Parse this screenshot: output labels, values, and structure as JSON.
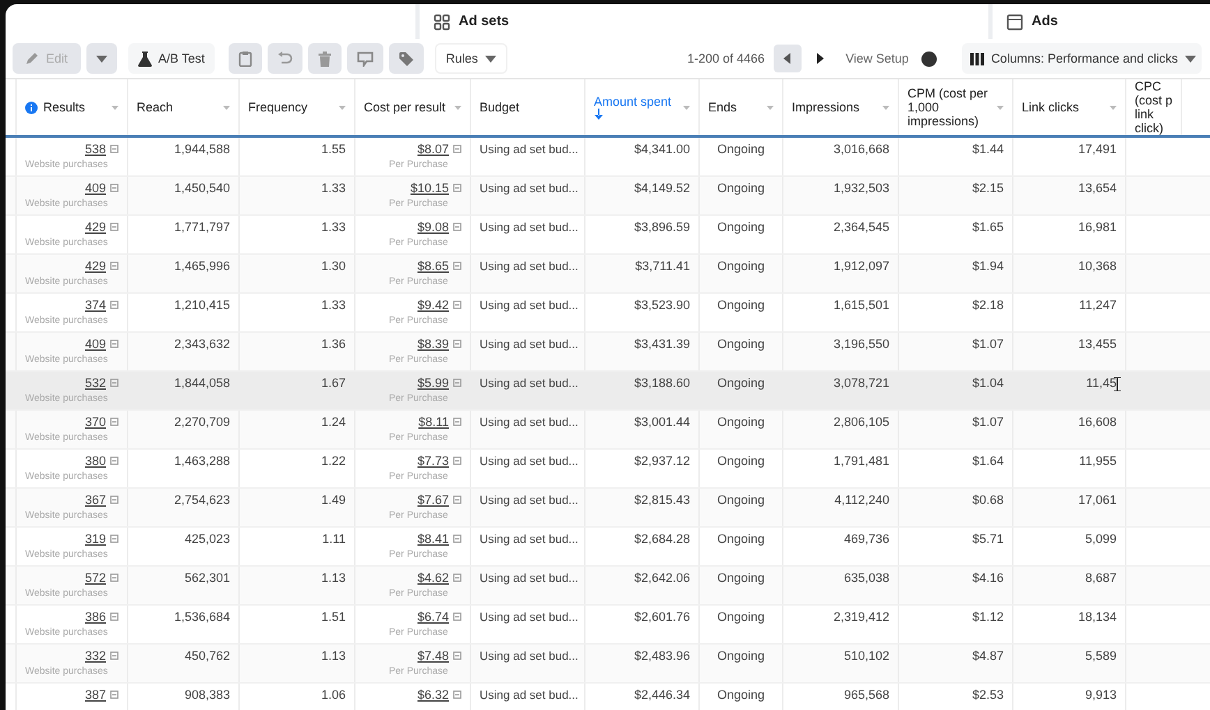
{
  "tabs": [
    {
      "label": "Ad sets"
    },
    {
      "label": "Ads"
    }
  ],
  "toolbar": {
    "items": [
      {
        "kind": "edit",
        "label": "Edit",
        "disabled": true
      },
      {
        "kind": "caret",
        "disabled": true
      },
      {
        "kind": "abtest",
        "label": "A/B Test",
        "disabled": false
      },
      {
        "kind": "clipboard",
        "disabled": true
      },
      {
        "kind": "undo",
        "disabled": true
      },
      {
        "kind": "trash",
        "disabled": true
      },
      {
        "kind": "review",
        "disabled": true
      },
      {
        "kind": "tag",
        "disabled": true
      },
      {
        "kind": "rules",
        "label": "Rules",
        "disabled": false
      }
    ],
    "pagination": "1-200 of 4466",
    "view_setup": {
      "label": "View Setup",
      "on": false
    },
    "columns_button": "Columns: Performance and clicks"
  },
  "table": {
    "columns": [
      {
        "label": "Results",
        "info": true,
        "menu": true,
        "sorted": false
      },
      {
        "label": "Reach",
        "info": false,
        "menu": true,
        "sorted": false
      },
      {
        "label": "Frequency",
        "info": false,
        "menu": true,
        "sorted": false
      },
      {
        "label": "Cost per result",
        "info": false,
        "menu": true,
        "sorted": false
      },
      {
        "label": "Budget",
        "info": false,
        "menu": false,
        "sorted": false
      },
      {
        "label": "Amount spent",
        "info": false,
        "menu": true,
        "sorted": true
      },
      {
        "label": "Ends",
        "info": false,
        "menu": true,
        "sorted": false
      },
      {
        "label": "Impressions",
        "info": false,
        "menu": true,
        "sorted": false
      },
      {
        "label": "CPM (cost per 1,000 impressions)",
        "info": false,
        "menu": true,
        "sorted": false
      },
      {
        "label": "Link clicks",
        "info": false,
        "menu": true,
        "sorted": false
      },
      {
        "label": "CPC (cost p link click)",
        "info": false,
        "menu": false,
        "sorted": false
      }
    ],
    "rows": [
      {
        "results": "538",
        "results_sub": "Website purchases",
        "reach": "1,944,588",
        "frequency": "1.55",
        "cost": "$8.07",
        "cost_sub": "Per Purchase",
        "budget": "Using ad set bud...",
        "amount": "$4,341.00",
        "ends": "Ongoing",
        "impressions": "3,016,668",
        "cpm": "$1.44",
        "link_clicks": "17,491",
        "highlighted": false
      },
      {
        "results": "409",
        "results_sub": "Website purchases",
        "reach": "1,450,540",
        "frequency": "1.33",
        "cost": "$10.15",
        "cost_sub": "Per Purchase",
        "budget": "Using ad set bud...",
        "amount": "$4,149.52",
        "ends": "Ongoing",
        "impressions": "1,932,503",
        "cpm": "$2.15",
        "link_clicks": "13,654",
        "highlighted": false
      },
      {
        "results": "429",
        "results_sub": "Website purchases",
        "reach": "1,771,797",
        "frequency": "1.33",
        "cost": "$9.08",
        "cost_sub": "Per Purchase",
        "budget": "Using ad set bud...",
        "amount": "$3,896.59",
        "ends": "Ongoing",
        "impressions": "2,364,545",
        "cpm": "$1.65",
        "link_clicks": "16,981",
        "highlighted": false
      },
      {
        "results": "429",
        "results_sub": "Website purchases",
        "reach": "1,465,996",
        "frequency": "1.30",
        "cost": "$8.65",
        "cost_sub": "Per Purchase",
        "budget": "Using ad set bud...",
        "amount": "$3,711.41",
        "ends": "Ongoing",
        "impressions": "1,912,097",
        "cpm": "$1.94",
        "link_clicks": "10,368",
        "highlighted": false
      },
      {
        "results": "374",
        "results_sub": "Website purchases",
        "reach": "1,210,415",
        "frequency": "1.33",
        "cost": "$9.42",
        "cost_sub": "Per Purchase",
        "budget": "Using ad set bud...",
        "amount": "$3,523.90",
        "ends": "Ongoing",
        "impressions": "1,615,501",
        "cpm": "$2.18",
        "link_clicks": "11,247",
        "highlighted": false
      },
      {
        "results": "409",
        "results_sub": "Website purchases",
        "reach": "2,343,632",
        "frequency": "1.36",
        "cost": "$8.39",
        "cost_sub": "Per Purchase",
        "budget": "Using ad set bud...",
        "amount": "$3,431.39",
        "ends": "Ongoing",
        "impressions": "3,196,550",
        "cpm": "$1.07",
        "link_clicks": "13,455",
        "highlighted": false
      },
      {
        "results": "532",
        "results_sub": "Website purchases",
        "reach": "1,844,058",
        "frequency": "1.67",
        "cost": "$5.99",
        "cost_sub": "Per Purchase",
        "budget": "Using ad set bud...",
        "amount": "$3,188.60",
        "ends": "Ongoing",
        "impressions": "3,078,721",
        "cpm": "$1.04",
        "link_clicks": "11,45",
        "highlighted": true
      },
      {
        "results": "370",
        "results_sub": "Website purchases",
        "reach": "2,270,709",
        "frequency": "1.24",
        "cost": "$8.11",
        "cost_sub": "Per Purchase",
        "budget": "Using ad set bud...",
        "amount": "$3,001.44",
        "ends": "Ongoing",
        "impressions": "2,806,105",
        "cpm": "$1.07",
        "link_clicks": "16,608",
        "highlighted": false
      },
      {
        "results": "380",
        "results_sub": "Website purchases",
        "reach": "1,463,288",
        "frequency": "1.22",
        "cost": "$7.73",
        "cost_sub": "Per Purchase",
        "budget": "Using ad set bud...",
        "amount": "$2,937.12",
        "ends": "Ongoing",
        "impressions": "1,791,481",
        "cpm": "$1.64",
        "link_clicks": "11,955",
        "highlighted": false
      },
      {
        "results": "367",
        "results_sub": "Website purchases",
        "reach": "2,754,623",
        "frequency": "1.49",
        "cost": "$7.67",
        "cost_sub": "Per Purchase",
        "budget": "Using ad set bud...",
        "amount": "$2,815.43",
        "ends": "Ongoing",
        "impressions": "4,112,240",
        "cpm": "$0.68",
        "link_clicks": "17,061",
        "highlighted": false
      },
      {
        "results": "319",
        "results_sub": "Website purchases",
        "reach": "425,023",
        "frequency": "1.11",
        "cost": "$8.41",
        "cost_sub": "Per Purchase",
        "budget": "Using ad set bud...",
        "amount": "$2,684.28",
        "ends": "Ongoing",
        "impressions": "469,736",
        "cpm": "$5.71",
        "link_clicks": "5,099",
        "highlighted": false
      },
      {
        "results": "572",
        "results_sub": "Website purchases",
        "reach": "562,301",
        "frequency": "1.13",
        "cost": "$4.62",
        "cost_sub": "Per Purchase",
        "budget": "Using ad set bud...",
        "amount": "$2,642.06",
        "ends": "Ongoing",
        "impressions": "635,038",
        "cpm": "$4.16",
        "link_clicks": "8,687",
        "highlighted": false
      },
      {
        "results": "386",
        "results_sub": "Website purchases",
        "reach": "1,536,684",
        "frequency": "1.51",
        "cost": "$6.74",
        "cost_sub": "Per Purchase",
        "budget": "Using ad set bud...",
        "amount": "$2,601.76",
        "ends": "Ongoing",
        "impressions": "2,319,412",
        "cpm": "$1.12",
        "link_clicks": "18,134",
        "highlighted": false
      },
      {
        "results": "332",
        "results_sub": "Website purchases",
        "reach": "450,762",
        "frequency": "1.13",
        "cost": "$7.48",
        "cost_sub": "Per Purchase",
        "budget": "Using ad set bud...",
        "amount": "$2,483.96",
        "ends": "Ongoing",
        "impressions": "510,102",
        "cpm": "$4.87",
        "link_clicks": "5,589",
        "highlighted": false
      },
      {
        "results": "387",
        "reach": "908,383",
        "frequency": "1.06",
        "cost": "$6.32",
        "budget": "Using ad set bud...",
        "amount": "$2,446.34",
        "ends": "Ongoing",
        "impressions": "965,568",
        "cpm": "$2.53",
        "link_clicks": "9,913",
        "highlighted": false
      }
    ]
  }
}
